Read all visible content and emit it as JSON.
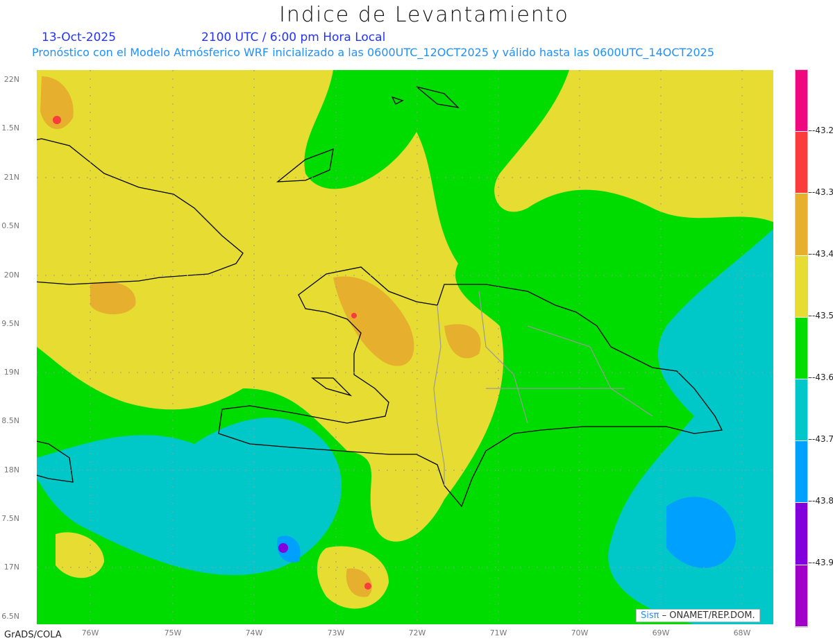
{
  "title": "Indice de Levantamiento",
  "date": "13-Oct-2025",
  "time": "2100 UTC / 6:00 pm Hora Local",
  "subtitle": "Pronóstico con el Modelo Atmósferico WRF inicializado a las 0600UTC_12OCT2025 y válido hasta las  0600UTC_14OCT2025",
  "lat_labels": [
    "22N",
    "1.5N",
    "21N",
    "0.5N",
    "20N",
    "9.5N",
    "19N",
    "8.5N",
    "18N",
    "7.5N",
    "17N",
    "6.5N"
  ],
  "lon_labels": [
    "76W",
    "75W",
    "74W",
    "73W",
    "72W",
    "71W",
    "70W",
    "69W",
    "68W"
  ],
  "credit": {
    "brand": "Sisπ",
    "rest": " – ONAMET/REP.DOM."
  },
  "footer": "GrADS/COLA",
  "colorbar": {
    "colors": [
      "#f0087f",
      "#fa3c3c",
      "#e6af2d",
      "#e6dc32",
      "#00dc00",
      "#00c8c8",
      "#00a0ff",
      "#8200dc",
      "#a000c8"
    ],
    "labels": [
      "-43.2",
      "-43.3",
      "-43.4",
      "-43.5",
      "-43.6",
      "-43.7",
      "-43.8",
      "-43.9"
    ]
  }
}
